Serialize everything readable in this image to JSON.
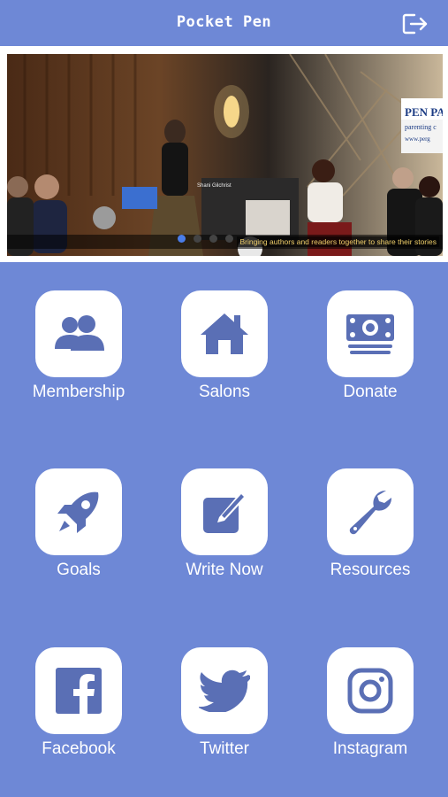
{
  "header": {
    "title": "Pocket Pen",
    "logout_icon": "logout-icon"
  },
  "carousel": {
    "caption": "Bringing authors and readers together to share their stories",
    "name_tag": "Shani Gilchrist",
    "sign": {
      "line1": "PEN PA",
      "line2": "parenting c",
      "line3": "www.perg"
    },
    "slide_count": 4,
    "active_index": 0
  },
  "tiles": [
    {
      "label": "Membership",
      "icon": "people-icon"
    },
    {
      "label": "Salons",
      "icon": "house-icon"
    },
    {
      "label": "Donate",
      "icon": "money-icon"
    },
    {
      "label": "Goals",
      "icon": "rocket-icon"
    },
    {
      "label": "Write Now",
      "icon": "edit-icon"
    },
    {
      "label": "Resources",
      "icon": "wrench-icon"
    },
    {
      "label": "Facebook",
      "icon": "facebook-icon"
    },
    {
      "label": "Twitter",
      "icon": "twitter-icon"
    },
    {
      "label": "Instagram",
      "icon": "instagram-icon"
    }
  ],
  "colors": {
    "background": "#6e88d6",
    "icon_fg": "#5a6fb5",
    "tile_bg": "#ffffff"
  }
}
